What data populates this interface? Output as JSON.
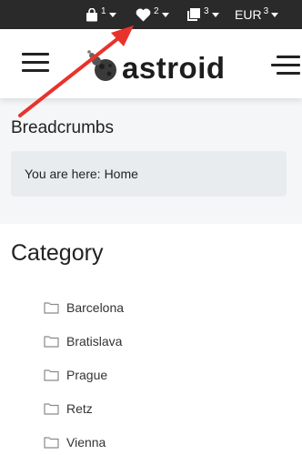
{
  "topbar": {
    "cart": {
      "icon": "bag-icon",
      "count": "1"
    },
    "wishlist": {
      "icon": "heart-icon",
      "count": "2"
    },
    "compare": {
      "icon": "copy-icon",
      "count": "3"
    },
    "currency": {
      "label": "EUR",
      "count": "3"
    }
  },
  "header": {
    "logo_text": "astroid",
    "menu_icon": "hamburger-icon",
    "offcanvas_icon": "offcanvas-menu-icon"
  },
  "breadcrumbs": {
    "title": "Breadcrumbs",
    "prefix": "You are here:",
    "current": "Home"
  },
  "category": {
    "title": "Category",
    "items": [
      {
        "label": "Barcelona",
        "icon": "folder-icon"
      },
      {
        "label": "Bratislava",
        "icon": "folder-icon"
      },
      {
        "label": "Prague",
        "icon": "folder-icon"
      },
      {
        "label": "Retz",
        "icon": "folder-icon"
      },
      {
        "label": "Vienna",
        "icon": "folder-icon"
      }
    ]
  },
  "annotation": {
    "arrow_color": "#e8332c"
  }
}
